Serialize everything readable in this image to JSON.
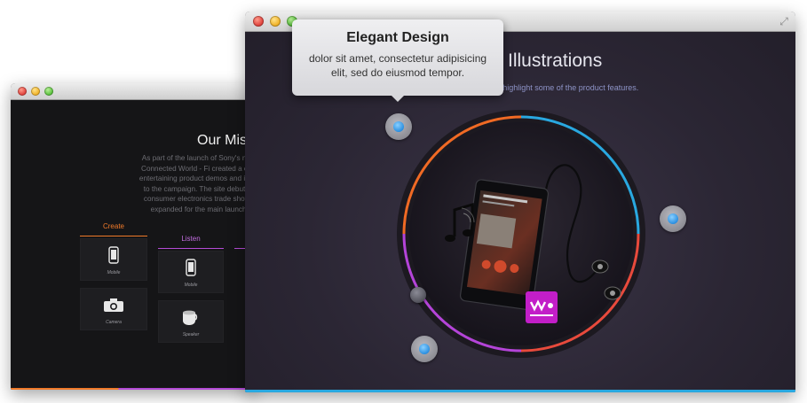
{
  "back_window": {
    "title": "Our Missi",
    "paragraph": [
      "As part of the launch of Sony's new c",
      "Connected World - Fi created a comp",
      "entertaining product demos and inform",
      "to the campaign. The site debuted a",
      "consumer electronics trade shows c",
      "expanded for the main launch a"
    ],
    "columns": [
      {
        "label": "Create",
        "color": "#f07a2a",
        "tiles": [
          {
            "caption": "Mobile"
          },
          {
            "caption": "Camera"
          }
        ]
      },
      {
        "label": "Listen",
        "color": "#b44bd6",
        "tiles": [
          {
            "caption": "Mobile"
          },
          {
            "caption": "Speaker"
          }
        ]
      }
    ]
  },
  "front_window": {
    "title": "Product Illustrations",
    "subtitle": "Custom product illustrations highlight some of the product features.",
    "ring_colors": [
      "#f06a24",
      "#29a8e0",
      "#b444d8",
      "#e84a3c"
    ],
    "logo_color": "#c21ec8"
  },
  "tooltip": {
    "title": "Elegant Design",
    "lines": [
      "dolor sit amet, consectetur adipisicing",
      "elit, sed do eiusmod tempor."
    ]
  },
  "icons": {
    "close": "close-light",
    "minimize": "minimize-light",
    "zoom": "zoom-light",
    "resize": "fullscreen-icon"
  }
}
